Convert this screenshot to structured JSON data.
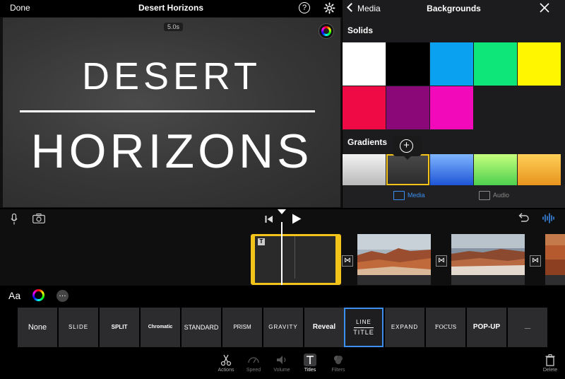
{
  "topbar": {
    "done_label": "Done",
    "project_title": "Desert Horizons",
    "help_glyph": "?"
  },
  "preview": {
    "duration": "5.0s",
    "title_line1": "DESERT",
    "title_line2": "HORIZONS"
  },
  "browser": {
    "back_label": "Media",
    "title": "Backgrounds",
    "solids_label": "Solids",
    "gradients_label": "Gradients",
    "add_glyph": "+",
    "solids": [
      {
        "name": "white",
        "color": "#ffffff"
      },
      {
        "name": "black",
        "color": "#000000"
      },
      {
        "name": "blue",
        "color": "#0aa1f0"
      },
      {
        "name": "green",
        "color": "#0ee67a"
      },
      {
        "name": "yellow",
        "color": "#fff600"
      },
      {
        "name": "red",
        "color": "#f00a45"
      },
      {
        "name": "purple",
        "color": "#8b0878"
      },
      {
        "name": "magenta",
        "color": "#f20aba"
      }
    ],
    "gradients": [
      {
        "name": "silver",
        "css": "linear-gradient(#f2f2f2, #b9b9b9)"
      },
      {
        "name": "charcoal",
        "css": "linear-gradient(#4a4a4a, #2b2b2b)"
      },
      {
        "name": "blue",
        "css": "linear-gradient(#7fb5ff, #1e55d6)"
      },
      {
        "name": "lime",
        "css": "linear-gradient(#c7ff7e, #4cd04e)"
      },
      {
        "name": "amber",
        "css": "linear-gradient(#ffcf57, #e7941d)"
      }
    ],
    "tabs": {
      "media": "Media",
      "audio": "Audio"
    }
  },
  "timeline": {
    "title_clip_marker": "T",
    "transition_glyph": "⋈"
  },
  "style_toolbar": {
    "font_label": "Aa",
    "more_glyph": "…"
  },
  "title_styles": [
    {
      "label": "None"
    },
    {
      "label": "SLIDE"
    },
    {
      "label": "SPLIT"
    },
    {
      "label": "Chromatic"
    },
    {
      "label": "STANDARD"
    },
    {
      "label": "PRISM"
    },
    {
      "label": "GRAVITY"
    },
    {
      "label": "Reveal"
    },
    {
      "label_line1": "LINE",
      "label_line2": "TITLE"
    },
    {
      "label": "EXPAND"
    },
    {
      "label": "FOCUS"
    },
    {
      "label": "POP-UP"
    },
    {
      "label": "___"
    }
  ],
  "bottom_tools": {
    "actions": "Actions",
    "speed": "Speed",
    "volume": "Volume",
    "titles": "Titles",
    "filters": "Filters",
    "delete": "Delete"
  }
}
